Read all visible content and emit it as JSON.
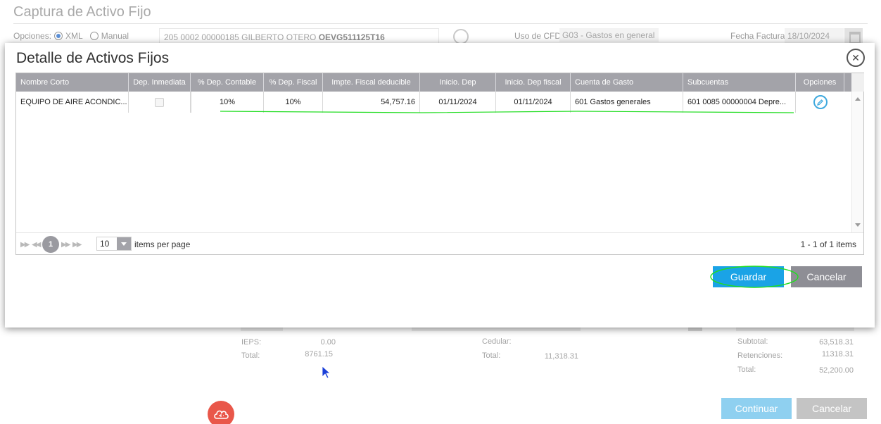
{
  "background": {
    "title": "Captura de Activo Fijo",
    "opciones_label": "Opciones:",
    "xml_label": "XML",
    "manual_label": "Manual",
    "supplier_prefix": "205 0002 00000185 GILBERTO OTERO",
    "supplier_rfc": "OEVG511125T16",
    "uso_cfdi_label": "Uso de CFDI",
    "uso_cfdi_value": "G03 - Gastos en general",
    "fecha_factura_label": "Fecha Factura:",
    "fecha_factura_value": "18/10/2024",
    "totals_left": [
      {
        "label": "IEPS:",
        "value": "0.00"
      },
      {
        "label": "Total:",
        "value": "8761.15"
      }
    ],
    "totals_mid": [
      {
        "label": "Cedular:",
        "value": ""
      },
      {
        "label": "Total:",
        "value": "11,318.31"
      }
    ],
    "totals_right": [
      {
        "label": "Subtotal:",
        "value": "63,518.31"
      },
      {
        "label": "Retenciones:",
        "value": "11318.31"
      },
      {
        "label": "Total:",
        "value": "52,200.00"
      }
    ],
    "continuar_label": "Continuar",
    "cancelar_label": "Cancelar"
  },
  "modal": {
    "title": "Detalle de Activos Fijos",
    "columns": [
      "Nombre Corto",
      "Dep. Inmediata",
      "% Dep. Contable",
      "% Dep. Fiscal",
      "Impte. Fiscal deducible",
      "Inicio. Dep",
      "Inicio. Dep fiscal",
      "Cuenta de Gasto",
      "Subcuentas",
      "Opciones"
    ],
    "row": {
      "nombre_corto": "EQUIPO DE AIRE ACONDIC...",
      "dep_inmediata": false,
      "dep_contable": "10%",
      "dep_fiscal": "10%",
      "impte_fiscal": "54,757.16",
      "inicio_dep": "01/11/2024",
      "inicio_dep_fiscal": "01/11/2024",
      "cuenta_gasto": "601 Gastos generales",
      "subcuentas": "601 0085 00000004 Depre..."
    },
    "pager": {
      "current_page": "1",
      "page_size": "10",
      "items_per_page_label": "items per page",
      "info": "1 - 1 of 1 items"
    },
    "guardar_label": "Guardar",
    "cancelar_label": "Cancelar"
  },
  "colors": {
    "accent": "#1aa3e6",
    "annotation": "#22dd22",
    "fab": "#e9574a"
  }
}
